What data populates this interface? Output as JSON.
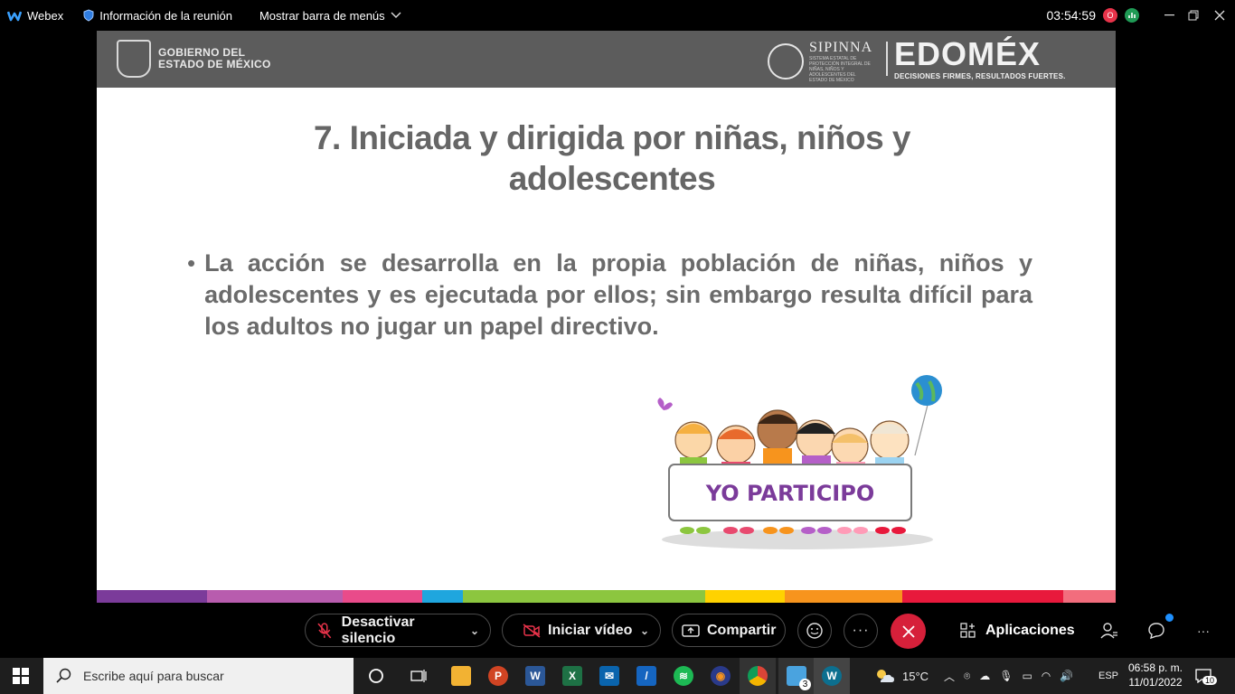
{
  "window": {
    "app_name": "Webex",
    "meeting_info_label": "Información de la reunión",
    "menu_bar_label": "Mostrar barra de menús",
    "timer": "03:54:59",
    "recording_badge": "O"
  },
  "slide": {
    "header": {
      "gov_line1": "GOBIERNO DEL",
      "gov_line2": "ESTADO DE MÉXICO",
      "sipinna_name": "SIPINNA",
      "sipinna_sub": "SISTEMA ESTATAL DE PROTECCIÓN INTEGRAL DE NIÑAS, NIÑOS Y ADOLESCENTES DEL ESTADO DE MÉXICO",
      "edomex_name": "EDOMÉX",
      "edomex_tagline": "DECISIONES FIRMES, RESULTADOS FUERTES."
    },
    "title_line1": "7. Iniciada y dirigida por niñas, niños y",
    "title_line2": "adolescentes",
    "bullet": "La acción se desarrolla en la propia población de niñas, niños y adolescentes y es ejecutada por ellos; sin embargo resulta difícil para los adultos no jugar un papel directivo.",
    "illustration_banner": "YO PARTICIPO",
    "stripe_colors": [
      "#7b3b9a",
      "#b85cae",
      "#e94b8a",
      "#1fa6de",
      "#8cc63f",
      "#ffd200",
      "#f7941d",
      "#e8193c",
      "#f26d7d"
    ]
  },
  "controls": {
    "mute_label": "Desactivar silencio",
    "video_label": "Iniciar vídeo",
    "share_label": "Compartir",
    "apps_label": "Aplicaciones"
  },
  "taskbar": {
    "search_placeholder": "Escribe aquí para buscar",
    "weather": "15°C",
    "language": "ESP",
    "time": "06:58 p. m.",
    "date": "11/01/2022",
    "notification_count": "10",
    "explorer_badge": "3"
  }
}
